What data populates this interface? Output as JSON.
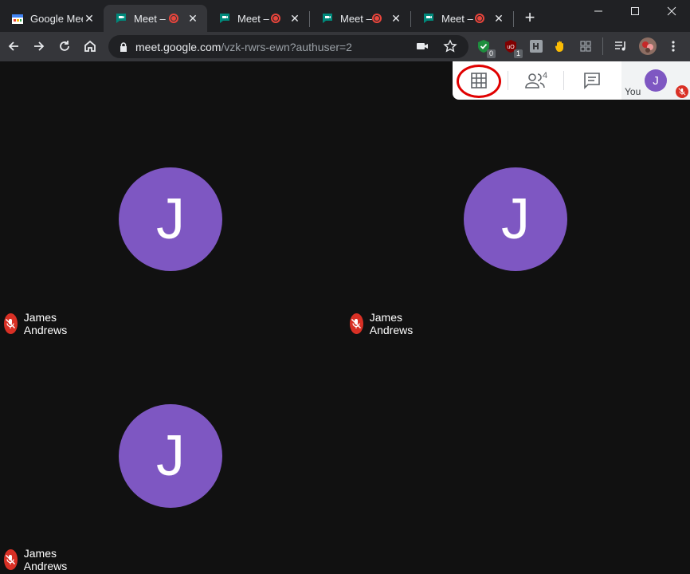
{
  "browser": {
    "tabs": [
      {
        "title": "Google Mee",
        "active": false,
        "recording": false
      },
      {
        "title": "Meet – ",
        "active": true,
        "recording": true
      },
      {
        "title": "Meet – ",
        "active": false,
        "recording": true
      },
      {
        "title": "Meet – ",
        "active": false,
        "recording": true
      },
      {
        "title": "Meet – ",
        "active": false,
        "recording": true
      }
    ],
    "url_host": "meet.google.com",
    "url_path": "/vzk-rwrs-ewn?authuser=2",
    "extension_badges": [
      "0",
      "1"
    ]
  },
  "meet_panel": {
    "people_count": "4",
    "self_initial": "J",
    "self_label": "You"
  },
  "participants": [
    {
      "initial": "J",
      "name": "James Andrews"
    },
    {
      "initial": "J",
      "name": "James Andrews"
    },
    {
      "initial": "J",
      "name": "James Andrews"
    }
  ],
  "colors": {
    "avatar": "#7e57c2",
    "mute": "#d93025",
    "highlight_circle": "#e00000",
    "background": "#111111"
  }
}
